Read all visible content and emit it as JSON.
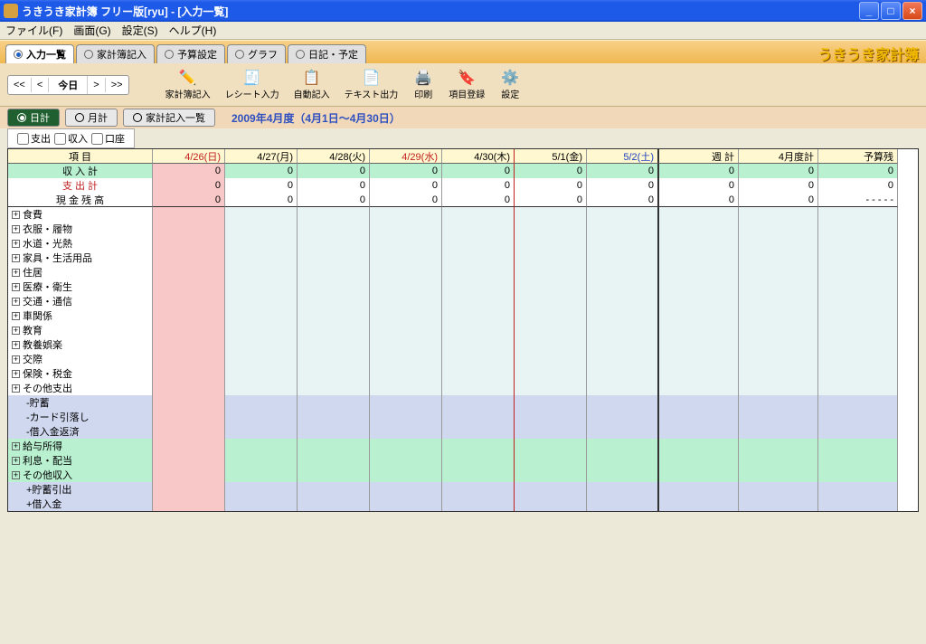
{
  "window": {
    "title": "うきうき家計簿 フリー版[ryu] - [入力一覧]"
  },
  "menu": {
    "file": "ファイル(F)",
    "view": "画面(G)",
    "settings": "設定(S)",
    "help": "ヘルプ(H)"
  },
  "maintabs": {
    "t0": "入力一覧",
    "t1": "家計簿記入",
    "t2": "予算設定",
    "t3": "グラフ",
    "t4": "日記・予定"
  },
  "brand": "うきうき家計簿",
  "nav": {
    "first": "<<",
    "prev": "<",
    "today": "今日",
    "next": ">",
    "last": ">>"
  },
  "tb": {
    "b0": "家計簿記入",
    "b1": "レシート入力",
    "b2": "自動記入",
    "b3": "テキスト出力",
    "b4": "印刷",
    "b5": "項目登録",
    "b6": "設定"
  },
  "sub": {
    "s0": "日計",
    "s1": "月計",
    "s2": "家計記入一覧"
  },
  "period": "2009年4月度（4月1日～4月30日）",
  "checks": {
    "c0": "支出",
    "c1": "収入",
    "c2": "口座"
  },
  "cols": {
    "h0": "項 目",
    "h1": "4/26(日)",
    "h2": "4/27(月)",
    "h3": "4/28(火)",
    "h4": "4/29(水)",
    "h5": "4/30(木)",
    "h6": "5/1(金)",
    "h7": "5/2(土)",
    "h8": "週 計",
    "h9": "4月度計",
    "h10": "予算残"
  },
  "sum": {
    "inc": "収 入 計",
    "exp": "支 出 計",
    "cash": "現 金 残 高",
    "zero": "0",
    "dash": "- - - - -"
  },
  "cats": {
    "r0": "食費",
    "r1": "衣服・履物",
    "r2": "水道・光熱",
    "r3": "家具・生活用品",
    "r4": "住居",
    "r5": "医療・衛生",
    "r6": "交通・通信",
    "r7": "車関係",
    "r8": "教育",
    "r9": "教養娯楽",
    "r10": "交際",
    "r11": "保険・税金",
    "r12": "その他支出",
    "s0": "-貯蓄",
    "s1": "-カード引落し",
    "s2": "-借入金返済",
    "i0": "給与所得",
    "i1": "利息・配当",
    "i2": "その他収入",
    "p0": "+貯蓄引出",
    "p1": "+借入金"
  }
}
